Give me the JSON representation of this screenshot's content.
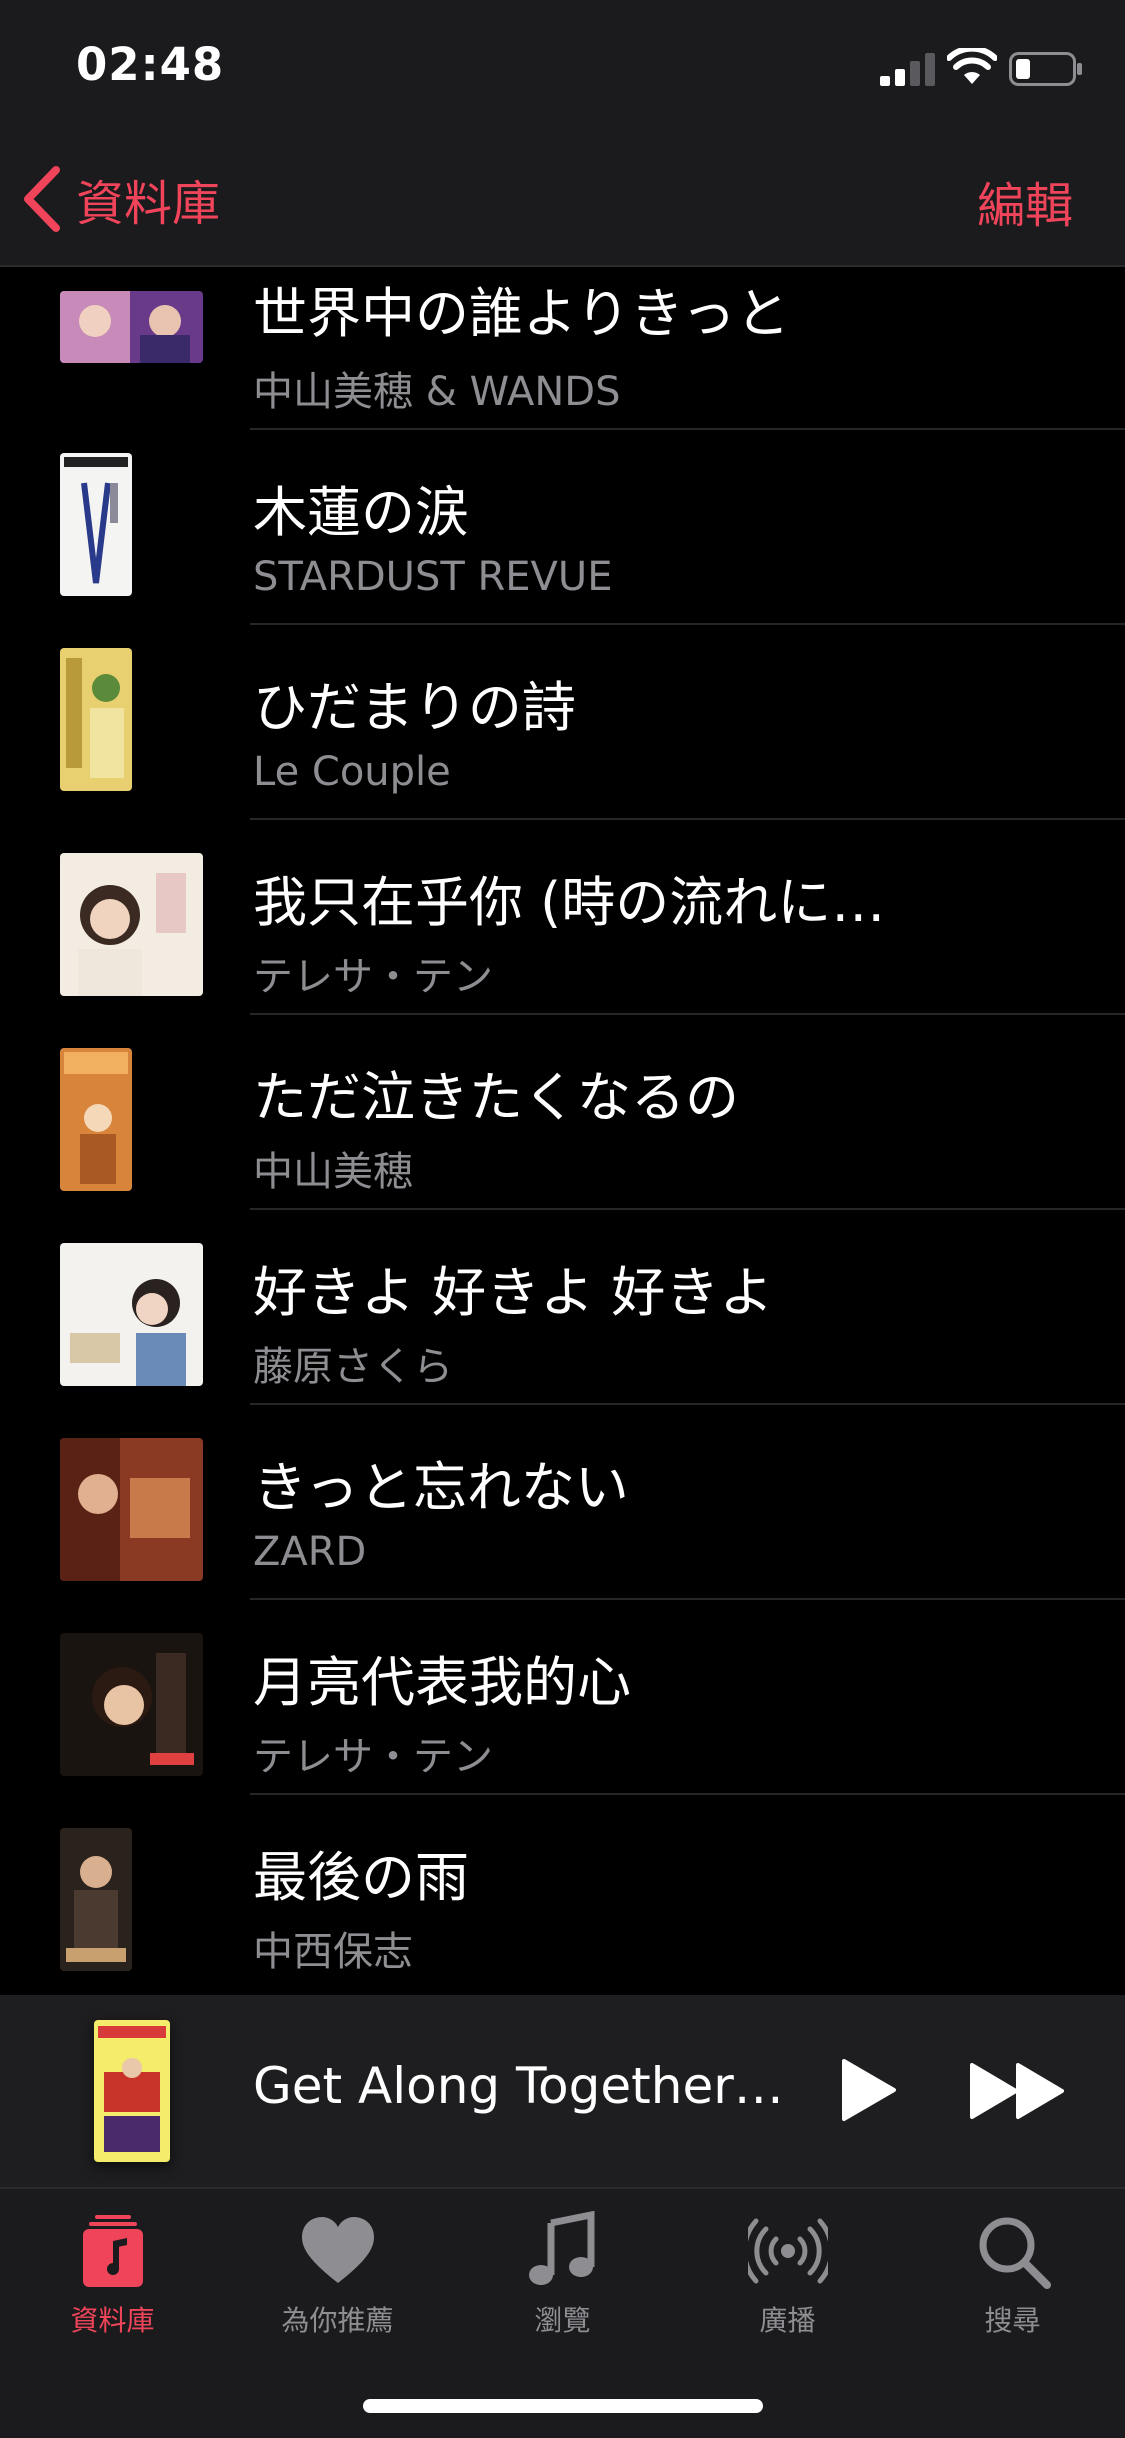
{
  "status_bar": {
    "time": "02:48",
    "icons": [
      "cellular-signal-icon",
      "wifi-icon",
      "battery-icon"
    ]
  },
  "nav": {
    "back_label": "資料庫",
    "edit_label": "編輯"
  },
  "songs": [
    {
      "title": "世界中の誰よりきっと",
      "artist": "中山美穂 & WANDS"
    },
    {
      "title": "木蓮の涙",
      "artist": "STARDUST REVUE"
    },
    {
      "title": "ひだまりの詩",
      "artist": "Le Couple"
    },
    {
      "title": "我只在乎你 (時の流れに…",
      "artist": "テレサ・テン"
    },
    {
      "title": "ただ泣きたくなるの",
      "artist": "中山美穂"
    },
    {
      "title": "好きよ 好きよ 好きよ",
      "artist": "藤原さくら"
    },
    {
      "title": "きっと忘れない",
      "artist": "ZARD"
    },
    {
      "title": "月亮代表我的心",
      "artist": "テレサ・テン"
    },
    {
      "title": "最後の雨",
      "artist": "中西保志"
    }
  ],
  "now_playing": {
    "title": "Get Along Together…"
  },
  "tabs": [
    {
      "label": "資料庫",
      "icon": "library-icon",
      "active": true
    },
    {
      "label": "為你推薦",
      "icon": "heart-icon",
      "active": false
    },
    {
      "label": "瀏覽",
      "icon": "music-note-icon",
      "active": false
    },
    {
      "label": "廣播",
      "icon": "radio-broadcast-icon",
      "active": false
    },
    {
      "label": "搜尋",
      "icon": "search-icon",
      "active": false
    }
  ],
  "colors": {
    "accent": "#f0445a",
    "background": "#000000",
    "secondary_text": "#8d8d92",
    "bar_background": "#1b1b1d"
  }
}
